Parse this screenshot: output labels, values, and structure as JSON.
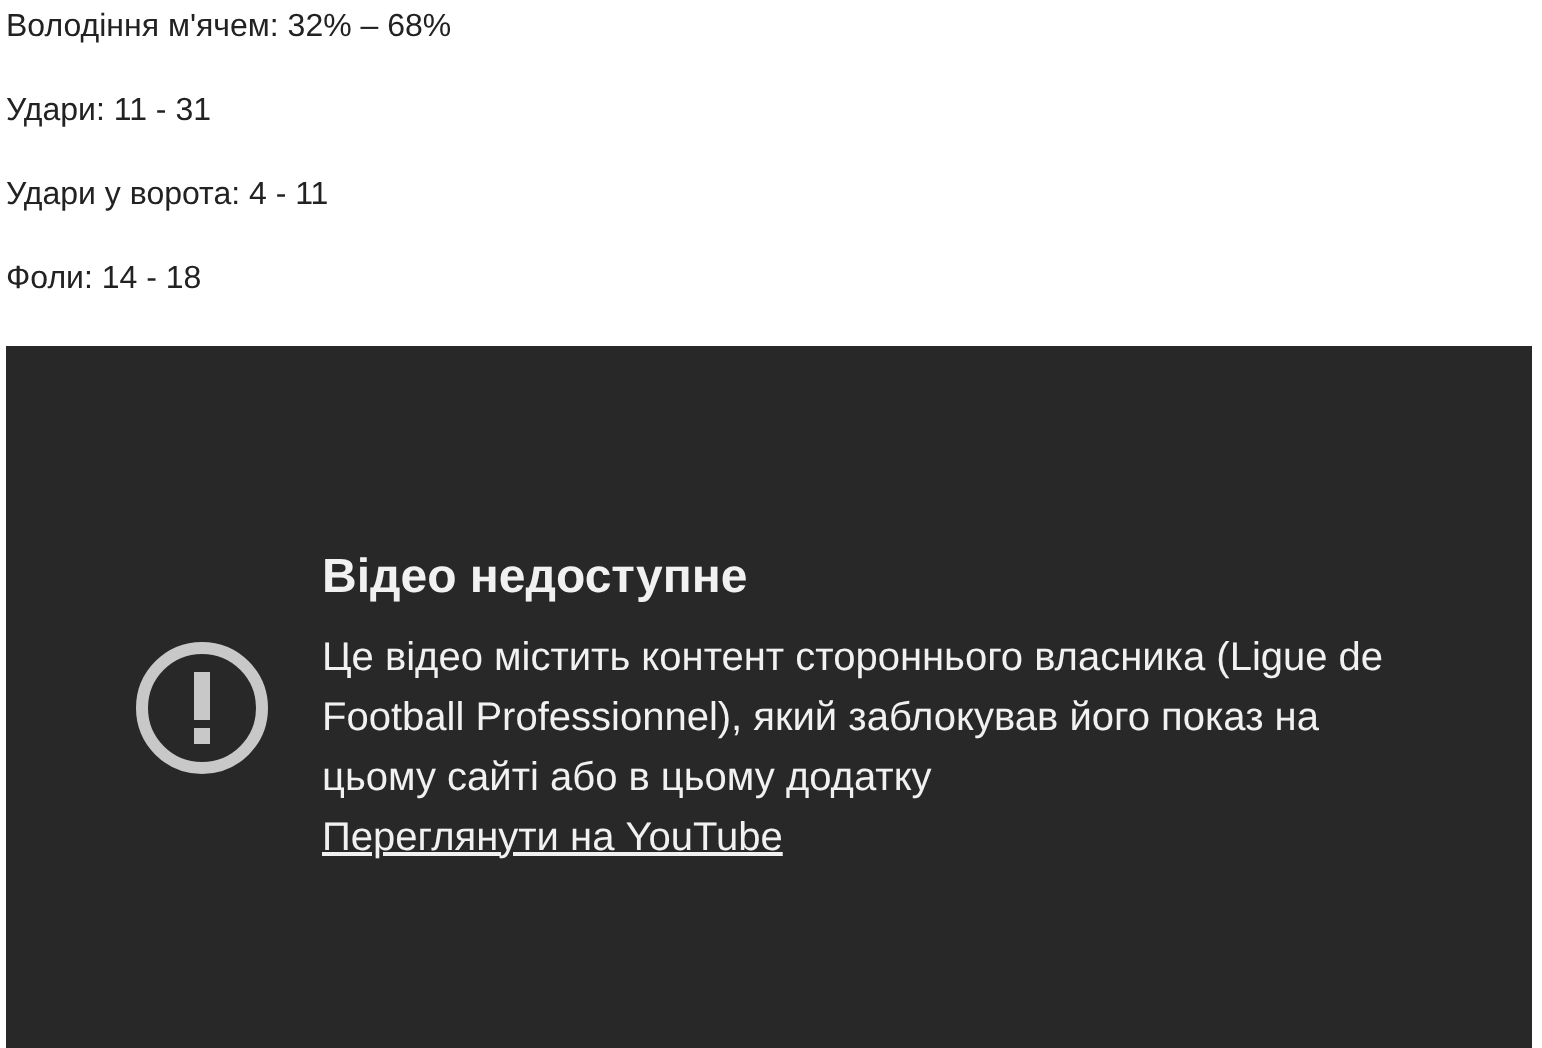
{
  "stats": [
    "Володіння м'ячем: 32% – 68%",
    "Удари: 11 - 31",
    "Удари у ворота: 4 - 11",
    "Фоли: 14 - 18"
  ],
  "video": {
    "title": "Відео недоступне",
    "message": "Це відео містить контент стороннього власника (Ligue de Football Professionnel), який заблокував його показ на цьому сайті або в цьому додатку",
    "link": "Переглянути на YouTube"
  }
}
